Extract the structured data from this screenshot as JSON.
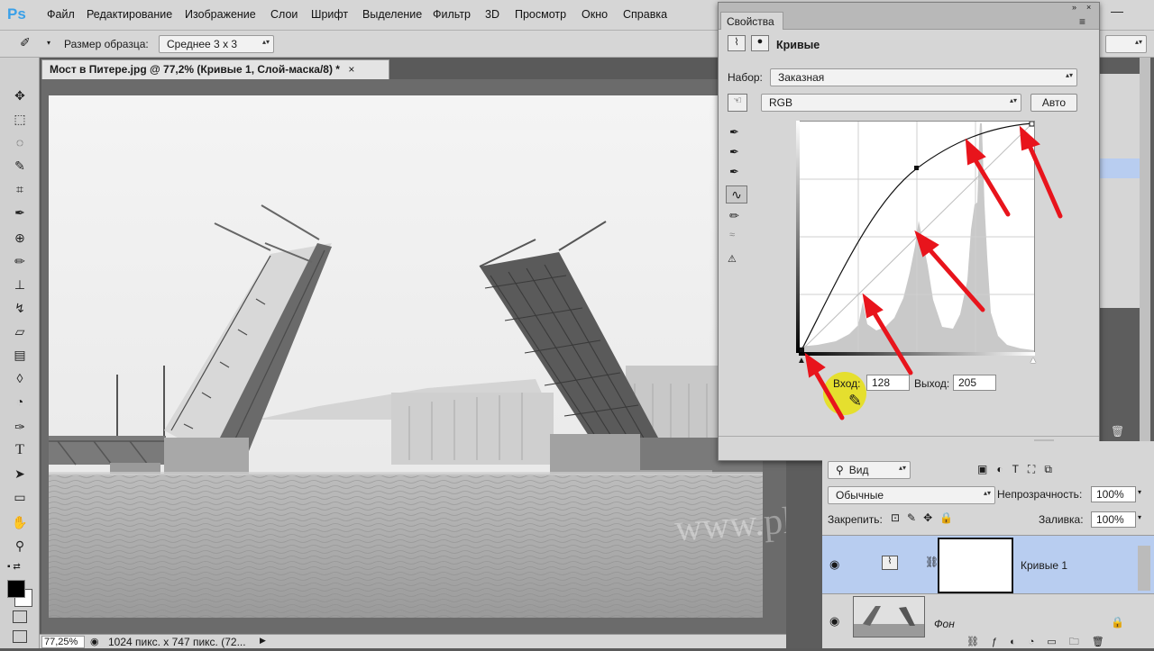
{
  "app": {
    "logo": "Ps"
  },
  "menu": [
    "Файл",
    "Редактирование",
    "Изображение",
    "Слои",
    "Шрифт",
    "Выделение",
    "Фильтр",
    "3D",
    "Просмотр",
    "Окно",
    "Справка"
  ],
  "options": {
    "sample_label": "Размер образца:",
    "sample_value": "Среднее 3 х 3"
  },
  "document": {
    "tab_title": "Мост в Питере.jpg @ 77,2% (Кривые 1, Слой-маска/8) *",
    "close": "×"
  },
  "status": {
    "zoom": "77,25%",
    "info": "1024 пикс. x 747 пикс. (72..."
  },
  "properties": {
    "panel_title": "Свойства",
    "header": "Кривые",
    "preset_label": "Набор:",
    "preset_value": "Заказная",
    "channel_value": "RGB",
    "auto_button": "Авто",
    "input_label": "Вход:",
    "input_value": "128",
    "output_label": "Выход:",
    "output_value": "205"
  },
  "layers": {
    "filter_value": "Вид",
    "blend_mode": "Обычные",
    "opacity_label": "Непрозрачность:",
    "opacity_value": "100%",
    "lock_label": "Закрепить:",
    "fill_label": "Заливка:",
    "fill_value": "100%",
    "items": [
      {
        "name": "Кривые 1",
        "selected": true
      },
      {
        "name": "Фон",
        "selected": false
      }
    ]
  },
  "watermark": "www.photoshopsunduchok.ru",
  "colors": {
    "accent_selection": "#b8cdf0",
    "arrow_red": "#e8141c",
    "highlight_yellow": "#e8e010"
  }
}
